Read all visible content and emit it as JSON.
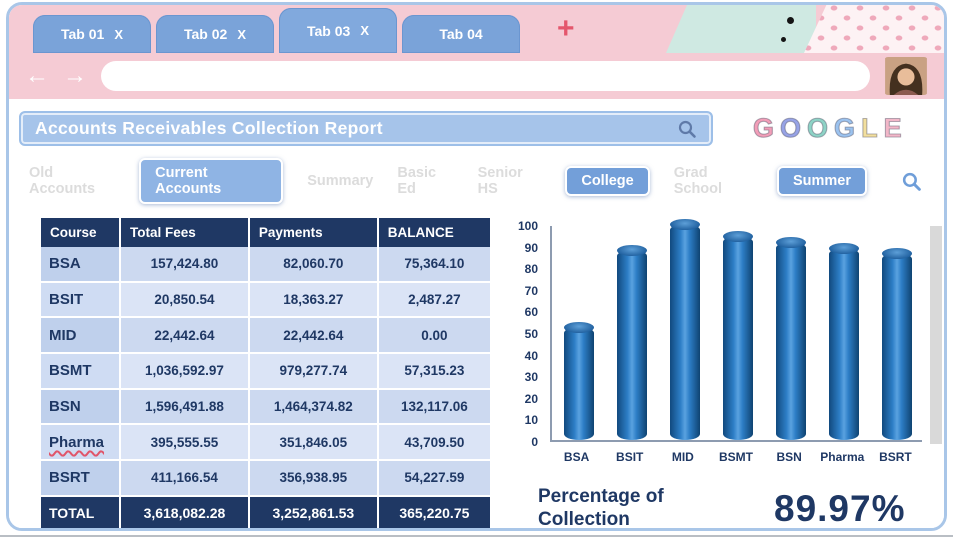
{
  "browser": {
    "tabs": [
      {
        "label": "Tab 01",
        "close": "X"
      },
      {
        "label": "Tab 02",
        "close": "X"
      },
      {
        "label": "Tab 03",
        "close": "X"
      },
      {
        "label": "Tab 04",
        "close": ""
      }
    ],
    "new_tab": "+",
    "back": "←",
    "forward": "→",
    "url_value": ""
  },
  "report": {
    "title": "Accounts Receivables Collection Report",
    "logo": [
      {
        "char": "G",
        "color": "#f29eb8"
      },
      {
        "char": "O",
        "color": "#97a3e6"
      },
      {
        "char": "O",
        "color": "#8ed3c6"
      },
      {
        "char": "G",
        "color": "#9cc3ef"
      },
      {
        "char": "L",
        "color": "#f2df9e"
      },
      {
        "char": "E",
        "color": "#f2b7c8"
      }
    ]
  },
  "nav": {
    "items": [
      {
        "label": "Old Accounts",
        "style": "ghost"
      },
      {
        "label": "Current Accounts",
        "style": "active"
      },
      {
        "label": "Summary",
        "style": "ghost"
      },
      {
        "label": "Basic Ed",
        "style": "ghost"
      },
      {
        "label": "Senior HS",
        "style": "ghost"
      },
      {
        "label": "College",
        "style": "pill"
      },
      {
        "label": "Grad School",
        "style": "ghost"
      },
      {
        "label": "Summer",
        "style": "pill"
      }
    ]
  },
  "table": {
    "headers": [
      "Course",
      "Total Fees",
      "Payments",
      "BALANCE"
    ],
    "rows": [
      {
        "course": "BSA",
        "total_fees": "157,424.80",
        "payments": "82,060.70",
        "balance": "75,364.10"
      },
      {
        "course": "BSIT",
        "total_fees": "20,850.54",
        "payments": "18,363.27",
        "balance": "2,487.27"
      },
      {
        "course": "MID",
        "total_fees": "22,442.64",
        "payments": "22,442.64",
        "balance": "0.00"
      },
      {
        "course": "BSMT",
        "total_fees": "1,036,592.97",
        "payments": "979,277.74",
        "balance": "57,315.23"
      },
      {
        "course": "BSN",
        "total_fees": "1,596,491.88",
        "payments": "1,464,374.82",
        "balance": "132,117.06"
      },
      {
        "course": "Pharma",
        "squiggly": true,
        "total_fees": "395,555.55",
        "payments": "351,846.05",
        "balance": "43,709.50"
      },
      {
        "course": "BSRT",
        "total_fees": "411,166.54",
        "payments": "356,938.95",
        "balance": "54,227.59"
      }
    ],
    "total_row": {
      "course": "TOTAL",
      "total_fees": "3,618,082.28",
      "payments": "3,252,861.53",
      "balance": "365,220.75"
    }
  },
  "chart_data": {
    "type": "bar",
    "categories": [
      "BSA",
      "BSIT",
      "MID",
      "BSMT",
      "BSN",
      "Pharma",
      "BSRT"
    ],
    "values": [
      52.13,
      88.07,
      100.0,
      94.47,
      91.72,
      88.95,
      86.81
    ],
    "title": "",
    "xlabel": "",
    "ylabel": "",
    "ylim": [
      0,
      100
    ],
    "yticks": [
      0,
      10,
      20,
      30,
      40,
      50,
      60,
      70,
      80,
      90,
      100
    ],
    "legend": "none",
    "grid": false,
    "bar_color": "#2E74B5"
  },
  "summary": {
    "caption": "Percentage of Collection",
    "value": "89.97%"
  },
  "colors": {
    "frame_blue": "#a9c6e8",
    "header_pink": "#f5cbd4",
    "table_header_navy": "#1f3864",
    "bar_blue": "#2e74b5",
    "mint": "#cfe9e2"
  }
}
